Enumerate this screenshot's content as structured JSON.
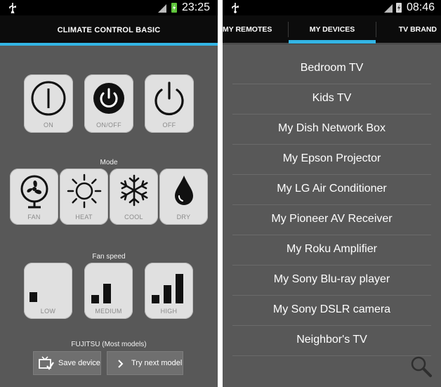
{
  "left_screen": {
    "status_bar": {
      "time": "23:25"
    },
    "title": "CLIMATE CONTROL BASIC",
    "power_buttons": [
      {
        "label": "ON",
        "icon": "power-on-icon"
      },
      {
        "label": "ON/OFF",
        "icon": "power-toggle-icon"
      },
      {
        "label": "OFF",
        "icon": "power-off-icon"
      }
    ],
    "mode_label": "Mode",
    "mode_buttons": [
      {
        "label": "FAN",
        "icon": "fan-icon"
      },
      {
        "label": "HEAT",
        "icon": "sun-icon"
      },
      {
        "label": "COOL",
        "icon": "snowflake-icon"
      },
      {
        "label": "DRY",
        "icon": "water-drop-icon"
      }
    ],
    "fan_speed_label": "Fan speed",
    "fan_buttons": [
      {
        "label": "LOW",
        "icon": "signal-low-icon"
      },
      {
        "label": "MEDIUM",
        "icon": "signal-medium-icon"
      },
      {
        "label": "HIGH",
        "icon": "signal-high-icon"
      }
    ],
    "model_label": "FUJITSU (Most models)",
    "save_button": "Save device",
    "next_button": "Try next model",
    "colors": {
      "accent": "#33b5e5",
      "battery": "#5ec43a"
    }
  },
  "right_screen": {
    "status_bar": {
      "time": "08:46"
    },
    "tabs": [
      {
        "label": "MY REMOTES"
      },
      {
        "label": "MY DEVICES",
        "selected": true
      },
      {
        "label": "TV BRAND"
      }
    ],
    "devices": [
      "Bedroom TV",
      "Kids TV",
      "My Dish Network Box",
      "My Epson Projector",
      "My LG Air Conditioner",
      "My Pioneer AV Receiver",
      "My Roku Amplifier",
      "My Sony Blu-ray player",
      "My Sony DSLR camera",
      "Neighbor's TV"
    ],
    "search_icon": "magnifier-icon"
  }
}
